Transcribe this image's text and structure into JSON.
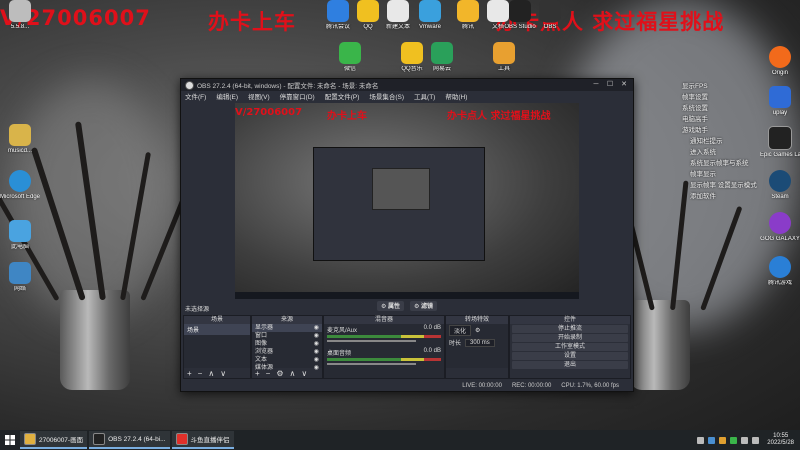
{
  "overlay": {
    "text_left": "V/27006007",
    "text_mid": "办卡上车",
    "text_right": "办卡点人  求过福星挑战",
    "color": "#e0101a"
  },
  "desktop_icons_left": [
    {
      "label": "5.5.8...",
      "icon": "box-icon",
      "color": "#bdbdbd"
    },
    {
      "label": "musicd...",
      "icon": "folder-icon",
      "color": "#d9b44a"
    },
    {
      "label": "Microsoft Edge",
      "icon": "edge-icon",
      "color": "#2a8fd6"
    },
    {
      "label": "此电脑",
      "icon": "computer-icon",
      "color": "#4aa3e0"
    },
    {
      "label": "网络",
      "icon": "network-icon",
      "color": "#3f86c4"
    }
  ],
  "desktop_icons_top": [
    {
      "label": "腾讯会议",
      "icon": "meeting-icon",
      "color": "#2f7fe0"
    },
    {
      "label": "QQ",
      "icon": "qq-icon",
      "color": "#f0c020"
    },
    {
      "label": "新建文本",
      "icon": "text-file-icon",
      "color": "#e8e8e8"
    },
    {
      "label": "Vmware",
      "icon": "vm-icon",
      "color": "#3aa0dd"
    },
    {
      "label": "腾讯",
      "icon": "penguin-icon",
      "color": "#f2b62a"
    },
    {
      "label": "文档",
      "icon": "doc-icon",
      "color": "#e8e8e8"
    },
    {
      "label": "OBS Studio",
      "icon": "obs-icon",
      "color": "#222222"
    },
    {
      "label": "OBS",
      "icon": "obs-icon",
      "color": "#333333"
    },
    {
      "label": "微信",
      "icon": "wechat-icon",
      "color": "#3ab54a"
    },
    {
      "label": "QQ音乐",
      "icon": "music-icon",
      "color": "#f0c020"
    },
    {
      "label": "网易云",
      "icon": "cloud-icon",
      "color": "#2aa05a"
    },
    {
      "label": "工具",
      "icon": "tool-icon",
      "color": "#e8a030"
    }
  ],
  "desktop_icons_right": [
    {
      "label": "Origin",
      "icon": "origin-icon",
      "color": "#f26a1b"
    },
    {
      "label": "uplay",
      "icon": "uplay-icon",
      "color": "#2f6bd6"
    },
    {
      "label": "Epic Games Launcher",
      "icon": "epic-icon",
      "color": "#222222"
    },
    {
      "label": "Steam",
      "icon": "steam-icon",
      "color": "#1b4b76"
    },
    {
      "label": "GOG GALAXY",
      "icon": "gog-icon",
      "color": "#8a3cc9"
    },
    {
      "label": "腾讯游戏",
      "icon": "game-icon",
      "color": "#2a7fd6"
    }
  ],
  "side_texts": [
    "显示FPS",
    "帧率设置",
    "系统设置",
    "电脑高手",
    "游戏助手",
    "通知栏提示",
    "进入系统",
    "系统显示帧率与系统",
    "帧率显示",
    "显示帧率 设置显示模式",
    "添加软件"
  ],
  "obs": {
    "title": "OBS 27.2.4 (64-bit, windows) - 配置文件: 未命名 - 场景: 未命名",
    "menu": [
      "文件(F)",
      "编辑(E)",
      "视图(V)",
      "停靠窗口(D)",
      "配置文件(P)",
      "场景集合(S)",
      "工具(T)",
      "帮助(H)"
    ],
    "preview_label": "未选择源",
    "preview_buttons": [
      "属性",
      "滤镜"
    ],
    "docks": {
      "scenes": {
        "title": "场景",
        "items": [
          "场景"
        ]
      },
      "sources": {
        "title": "来源",
        "items": [
          "显示器",
          "窗口",
          "图像",
          "浏览器",
          "文本",
          "媒体源"
        ]
      },
      "mixer": {
        "title": "混音器",
        "rows": [
          {
            "name": "麦克风/Aux",
            "db": "0.0 dB"
          },
          {
            "name": "桌面音频",
            "db": "0.0 dB"
          }
        ]
      },
      "transitions": {
        "title": "转场特效",
        "type": "淡化",
        "duration_label": "时长",
        "duration": "300 ms"
      },
      "controls": {
        "title": "控件",
        "buttons": [
          "停止推流",
          "开始录制",
          "工作室模式",
          "设置",
          "退出"
        ]
      }
    },
    "status": {
      "live": "LIVE: 00:00:00",
      "rec": "REC: 00:00:00",
      "cpu": "CPU: 1.7%, 60.00 fps"
    }
  },
  "taskbar": {
    "tasks": [
      {
        "label": "27006007-画面",
        "icon": "folder-icon",
        "color": "#e0b040"
      },
      {
        "label": "OBS 27.2.4 (64-bi...",
        "icon": "obs-icon",
        "color": "#222222"
      },
      {
        "label": "斗鱼直播伴侣",
        "icon": "douyu-icon",
        "color": "#e0302a"
      }
    ],
    "time": "10:55",
    "date": "2022/5/28"
  }
}
